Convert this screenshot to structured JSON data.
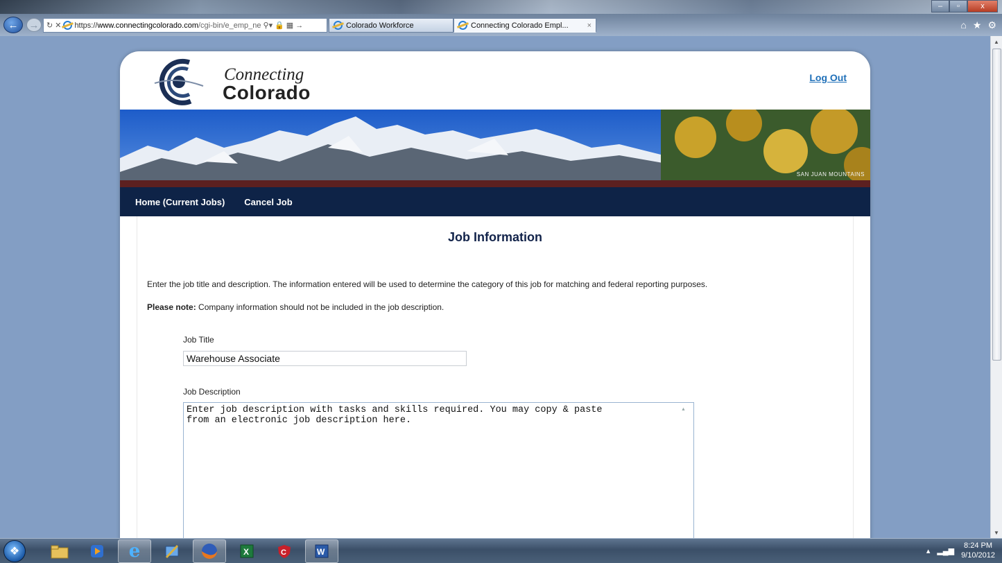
{
  "browser": {
    "address": {
      "scheme": "https://",
      "domain": "www.connectingcolorado.com",
      "path": "/cgi-bin/e_emp_ne"
    },
    "tabs": [
      {
        "label": "Colorado Workforce"
      },
      {
        "label": "Connecting Colorado Empl...",
        "close": "×"
      }
    ],
    "window_controls": {
      "minimize": "–",
      "maximize": "▫",
      "close": "x"
    },
    "toolbar_icons": {
      "home": "⌂",
      "favorites": "★",
      "tools": "⚙"
    }
  },
  "site": {
    "logo": {
      "line1": "Connecting",
      "line2": "Colorado"
    },
    "logout": "Log Out",
    "banner_caption": "SAN JUAN MOUNTAINS",
    "nav": [
      {
        "label": "Home (Current Jobs)"
      },
      {
        "label": "Cancel Job"
      }
    ]
  },
  "form": {
    "title": "Job Information",
    "intro": "Enter the job title and description. The information entered will be used to determine the category of this job for matching and federal reporting purposes.",
    "note_label": "Please note:",
    "note_text": " Company information should not be included in the job description.",
    "job_title_label": "Job Title",
    "job_title_value": "Warehouse Associate",
    "job_desc_label": "Job Description",
    "job_desc_value": "Enter job description with tasks and skills required. You may copy & paste\nfrom an electronic job description here."
  },
  "taskbar": {
    "apps": [
      "Windows Explorer",
      "Windows Media Player",
      "Internet Explorer",
      "Paint",
      "Firefox",
      "Excel",
      "McAfee",
      "Word"
    ],
    "clock_time": "8:24 PM",
    "clock_date": "9/10/2012"
  },
  "colors": {
    "nav_bg": "#0e2347",
    "title_color": "#12234a",
    "link_color": "#1e6fb8",
    "page_bg": "#839ec4"
  }
}
